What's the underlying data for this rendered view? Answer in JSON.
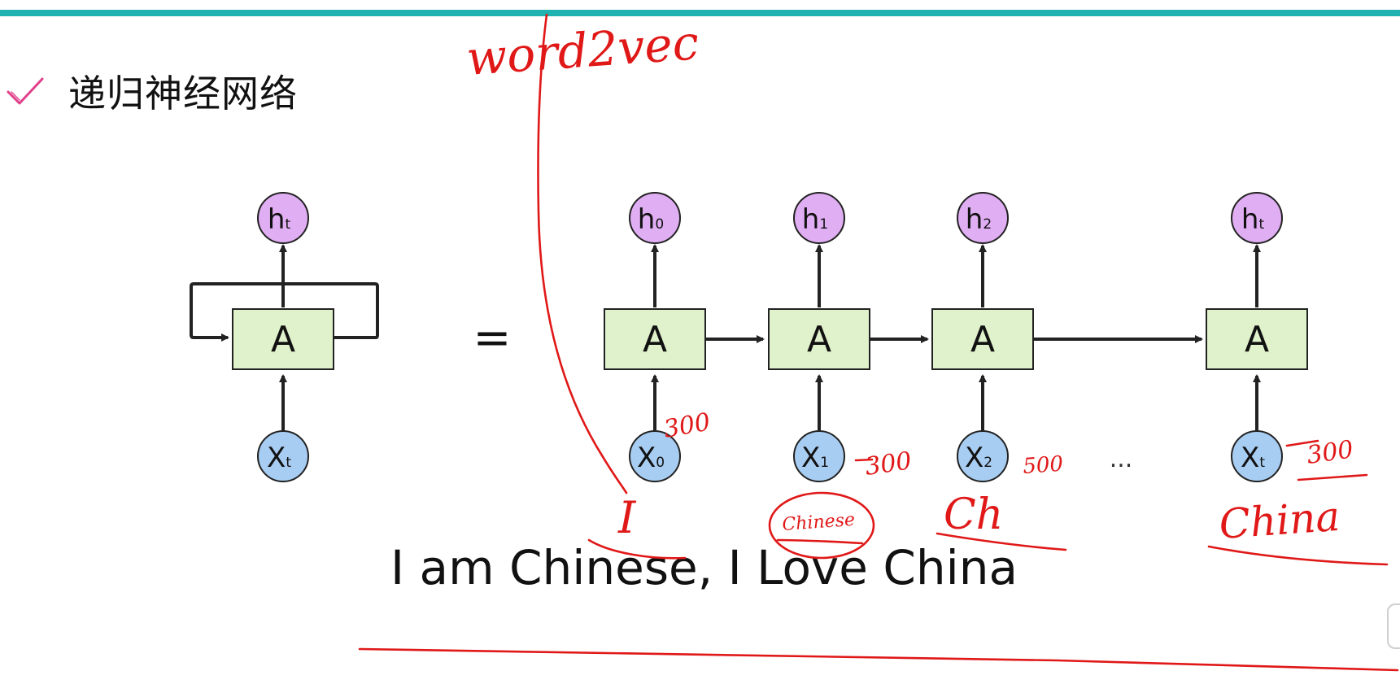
{
  "slide": {
    "accent_color": "#1fb2b0",
    "bullet_icon": "check-icon",
    "title": "递归神经网络",
    "sentence": "I am Chinese, I Love China"
  },
  "diagram": {
    "colors": {
      "hidden_fill": "#e0aef3",
      "input_fill": "#a8cdf2",
      "cell_fill": "#dff2cb",
      "stroke": "#222222"
    },
    "equals": "=",
    "ellipsis": "...",
    "rolled": {
      "cell": "A",
      "hidden": {
        "main": "h",
        "sub": "t"
      },
      "input": {
        "main": "X",
        "sub": "t"
      }
    },
    "steps": [
      {
        "cell": "A",
        "hidden": {
          "main": "h",
          "sub": "0"
        },
        "input": {
          "main": "X",
          "sub": "0"
        }
      },
      {
        "cell": "A",
        "hidden": {
          "main": "h",
          "sub": "1"
        },
        "input": {
          "main": "X",
          "sub": "1"
        }
      },
      {
        "cell": "A",
        "hidden": {
          "main": "h",
          "sub": "2"
        },
        "input": {
          "main": "X",
          "sub": "2"
        }
      },
      {
        "cell": "A",
        "hidden": {
          "main": "h",
          "sub": "t"
        },
        "input": {
          "main": "X",
          "sub": "t"
        }
      }
    ]
  },
  "annotations": {
    "ink_color": "#e01818",
    "word2vec": "word2vec",
    "dims": [
      "300",
      "300",
      "500",
      "300"
    ],
    "words": [
      "I",
      "Chinese",
      "Ch",
      "China"
    ]
  }
}
